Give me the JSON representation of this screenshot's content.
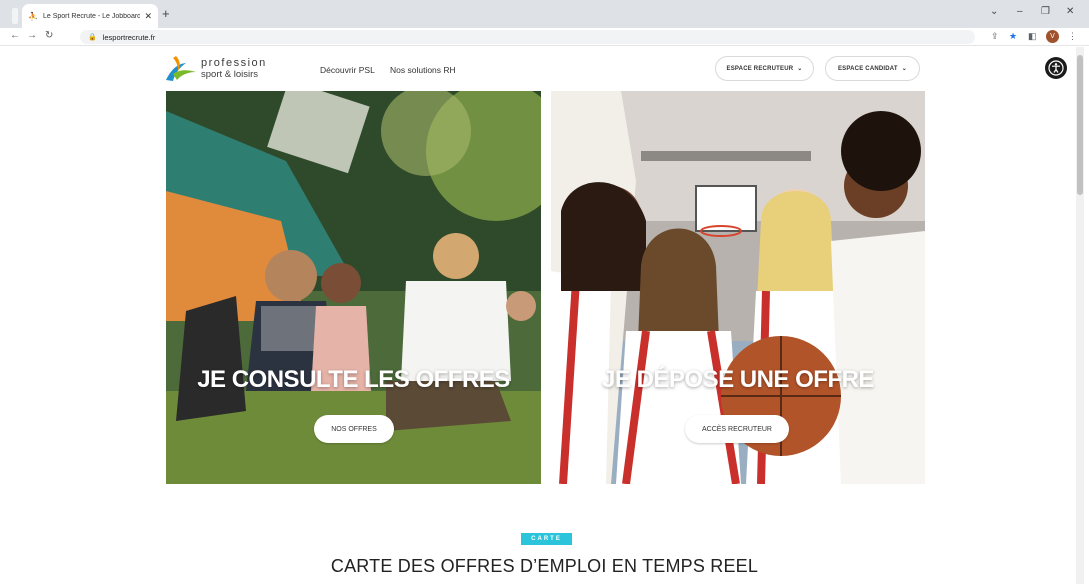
{
  "browser": {
    "tab_title": "Le Sport Recrute - Le Jobboard",
    "url": "lesportrecrute.fr"
  },
  "header": {
    "logo_line1": "profession",
    "logo_line2": "sport & loisirs",
    "nav": [
      "Découvrir PSL",
      "Nos solutions RH"
    ],
    "espace_recruteur": "ESPACE RECRUTEUR",
    "espace_candidat": "ESPACE CANDIDAT",
    "user_initial": "V"
  },
  "hero": {
    "left": {
      "title": "JE CONSULTE LES OFFRES",
      "button": "NOS OFFRES"
    },
    "right": {
      "title": "JE DÉPOSE UNE OFFRE",
      "button": "ACCÈS RECRUTEUR"
    }
  },
  "section": {
    "badge": "CARTE",
    "title": "CARTE DES OFFRES D’EMPLOI EN TEMPS REEL"
  },
  "colors": {
    "accent": "#2bc4db",
    "logo_orange": "#f39200",
    "logo_green": "#7ab929",
    "logo_blue": "#1f8fce"
  }
}
